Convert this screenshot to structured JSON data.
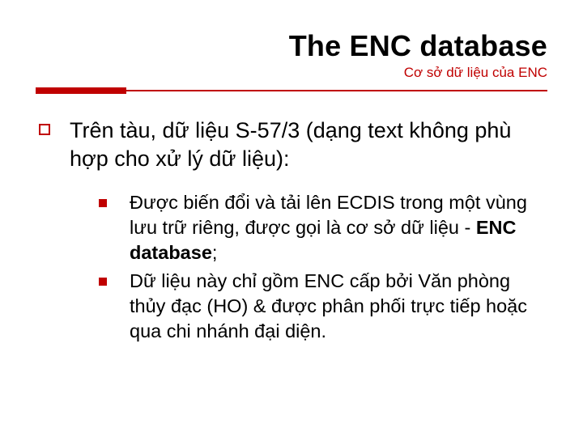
{
  "title": "The ENC database",
  "subtitle": "Cơ sở dữ liệu của ENC",
  "main_point": "Trên tàu, dữ liệu S-57/3 (dạng text không phù hợp cho xử lý dữ liệu):",
  "sub_points": [
    {
      "pre": "Được biến đổi và tải lên ECDIS trong một vùng lưu trữ riêng, được gọi là cơ sở dữ liệu - ",
      "bold": "ENC database",
      "post": ";"
    },
    {
      "pre": "Dữ liệu này chỉ gồm ENC cấp bởi Văn phòng thủy đạc (HO) & được phân phối trực tiếp hoặc qua chi nhánh đại diện.",
      "bold": "",
      "post": ""
    }
  ],
  "colors": {
    "accent": "#c00000"
  }
}
